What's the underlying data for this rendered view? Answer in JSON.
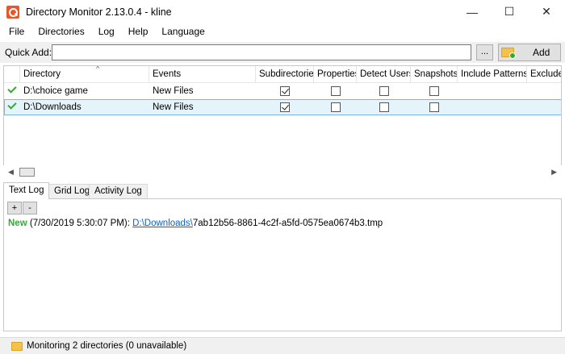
{
  "window": {
    "title": "Directory Monitor 2.13.0.4 - kline",
    "icon": "app-search-icon",
    "minimize": "—",
    "maximize": "☐",
    "close": "✕"
  },
  "menu": [
    "File",
    "Directories",
    "Log",
    "Help",
    "Language"
  ],
  "quick_add": {
    "label": "Quick Add:",
    "value": "",
    "browse_label": "...",
    "add_label": "Add"
  },
  "grid": {
    "columns": [
      "Directory",
      "Events",
      "Subdirectories",
      "Properties",
      "Detect Users",
      "Snapshots",
      "Include Patterns",
      "Exclude"
    ],
    "rows": [
      {
        "directory": "D:\\choice game",
        "events": "New Files",
        "subdirectories": true,
        "properties": false,
        "detect_users": false,
        "snapshots": false,
        "include_patterns": "",
        "selected": false
      },
      {
        "directory": "D:\\Downloads",
        "events": "New Files",
        "subdirectories": true,
        "properties": false,
        "detect_users": false,
        "snapshots": false,
        "include_patterns": "",
        "selected": true
      }
    ]
  },
  "tabs": [
    "Text Log",
    "Grid Log",
    "Activity Log"
  ],
  "active_tab": 0,
  "log": {
    "add_btn": "+",
    "remove_btn": "-",
    "entries": [
      {
        "type": "New",
        "time": "(7/30/2019 5:30:07 PM):",
        "link": "D:\\Downloads\\",
        "file": "7ab12b56-8861-4c2f-a5fd-0575ea0674b3.tmp"
      }
    ]
  },
  "status": {
    "text": "Monitoring 2 directories (0 unavailable)"
  },
  "colors": {
    "accent_green": "#3aa63a",
    "link_blue": "#1060c0",
    "selection": "#e5f3fb",
    "app_icon": "#e8562a",
    "folder": "#f4c24b"
  }
}
